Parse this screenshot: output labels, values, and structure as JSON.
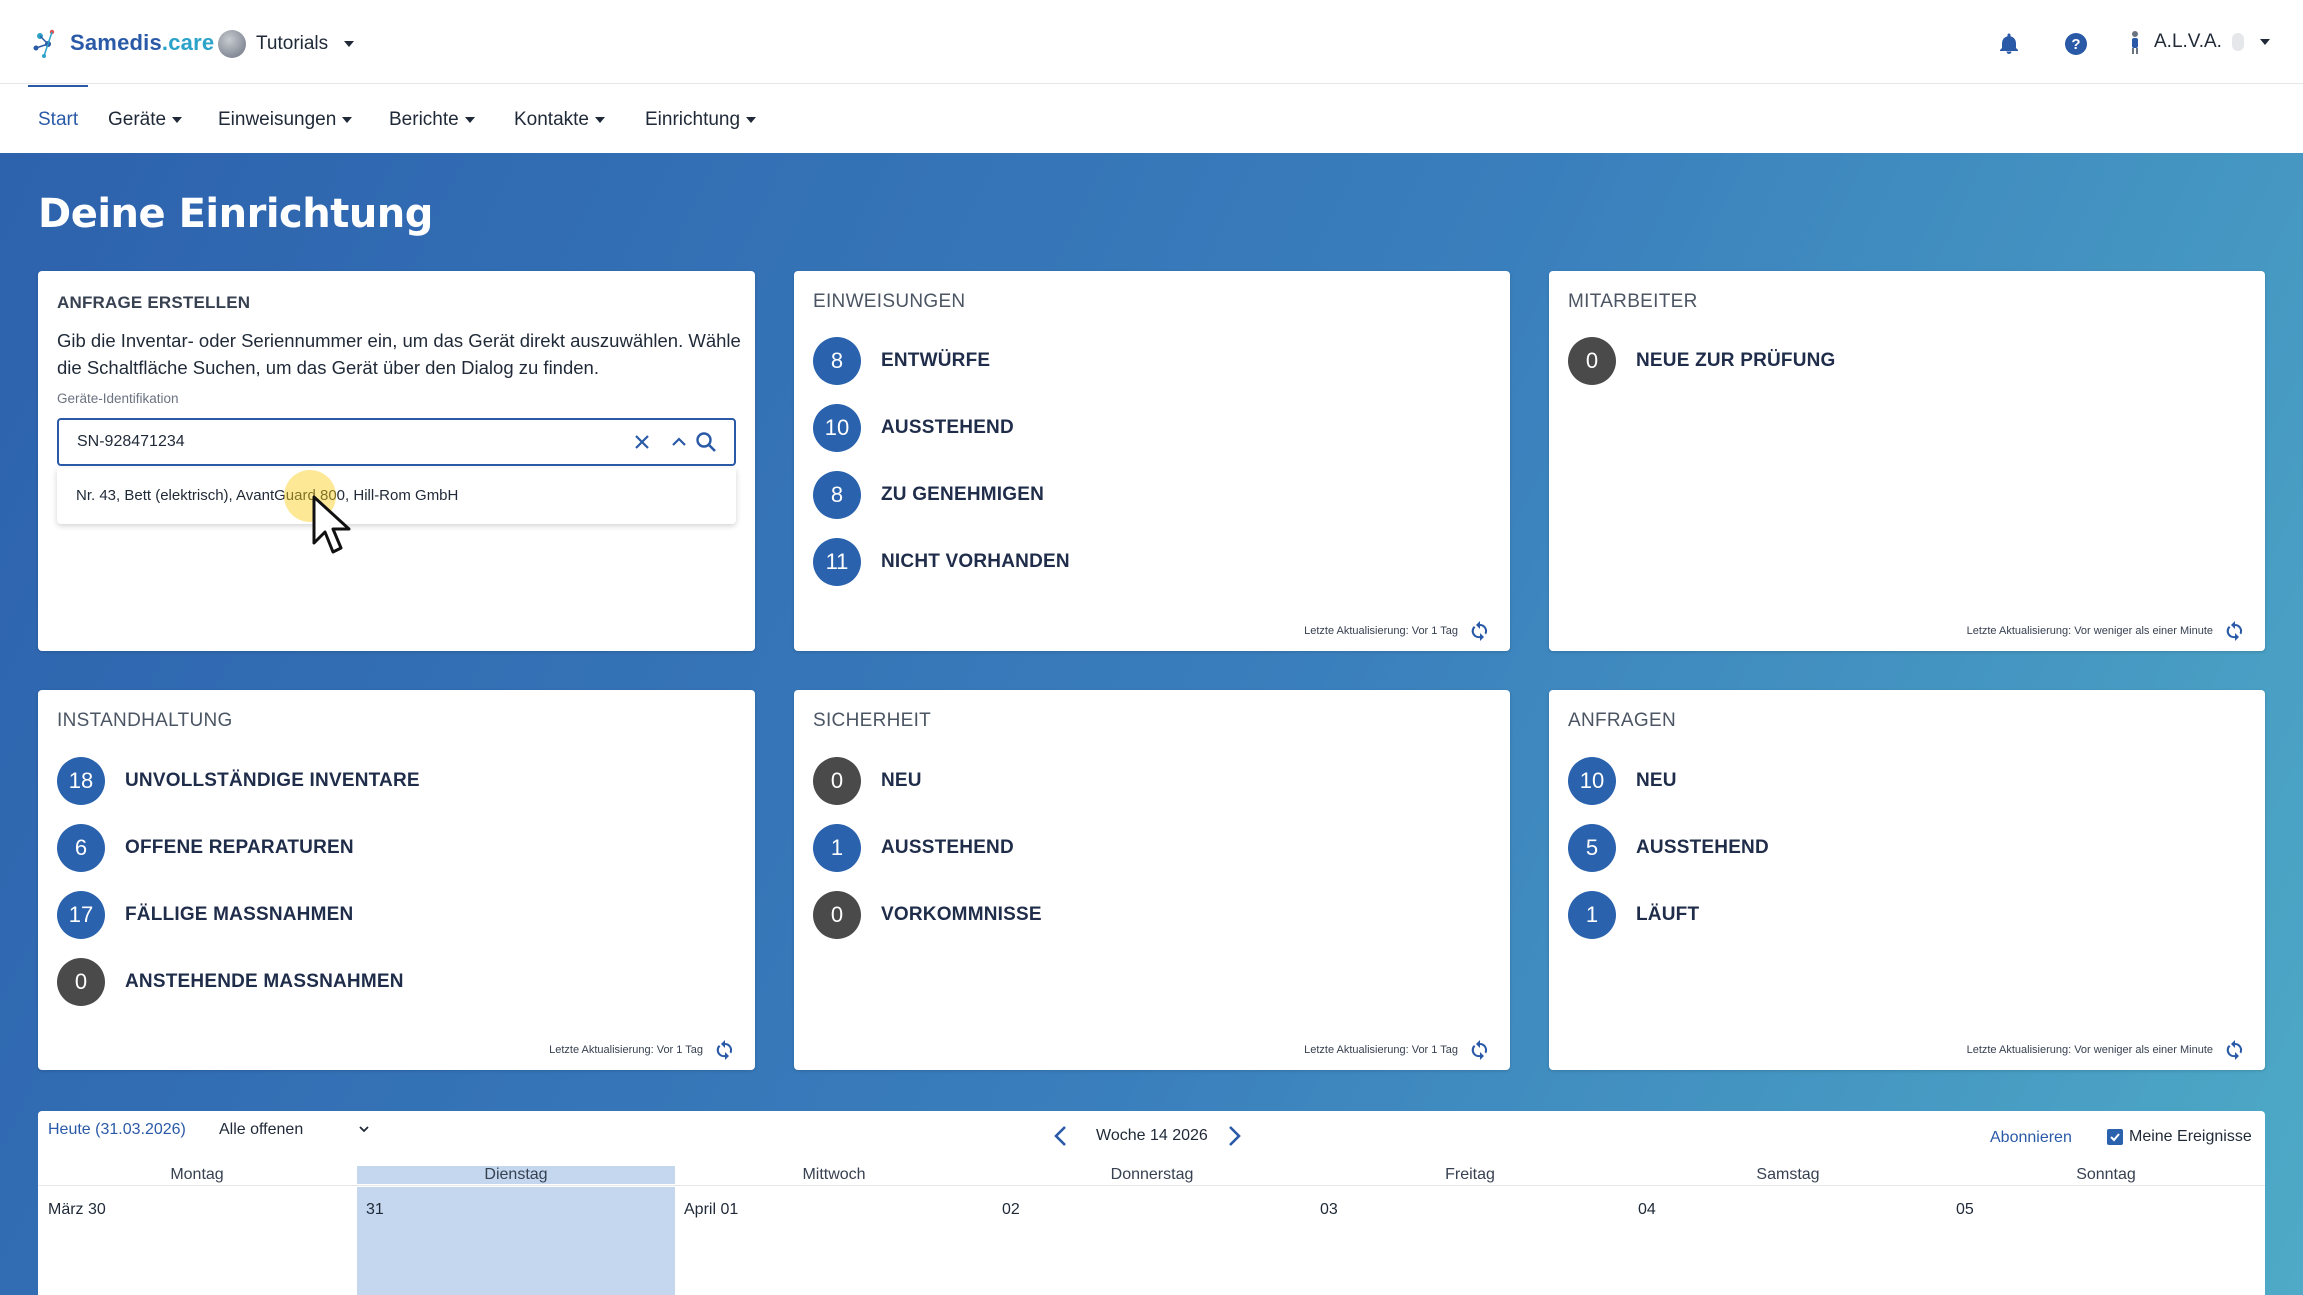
{
  "header": {
    "brand_a": "Samedis",
    "brand_b": ".care",
    "tenant": "Tutorials",
    "user": "A.L.V.A."
  },
  "nav": {
    "items": [
      {
        "label": "Start",
        "dropdown": false,
        "active": true
      },
      {
        "label": "Geräte",
        "dropdown": true
      },
      {
        "label": "Einweisungen",
        "dropdown": true
      },
      {
        "label": "Berichte",
        "dropdown": true
      },
      {
        "label": "Kontakte",
        "dropdown": true
      },
      {
        "label": "Einrichtung",
        "dropdown": true
      }
    ]
  },
  "page": {
    "title": "Deine Einrichtung"
  },
  "request": {
    "title": "ANFRAGE ERSTELLEN",
    "description": "Gib die Inventar- oder Seriennummer ein, um das Gerät direkt auszuwählen. Wähle die Schaltfläche Suchen, um das Gerät über den Dialog zu finden.",
    "field_label": "Geräte-Identifikation",
    "field_value": "SN-928471234",
    "suggestion": "Nr. 43, Bett (elektrisch), AvantGuard 800, Hill-Rom GmbH"
  },
  "cards": {
    "einweisungen": {
      "title": "EINWEISUNGEN",
      "stats": [
        {
          "value": "8",
          "label": "ENTWÜRFE",
          "color": "blue"
        },
        {
          "value": "10",
          "label": "AUSSTEHEND",
          "color": "blue"
        },
        {
          "value": "8",
          "label": "ZU GENEHMIGEN",
          "color": "blue"
        },
        {
          "value": "11",
          "label": "NICHT VORHANDEN",
          "color": "blue"
        }
      ],
      "footer": "Letzte Aktualisierung: Vor 1 Tag"
    },
    "mitarbeiter": {
      "title": "MITARBEITER",
      "stats": [
        {
          "value": "0",
          "label": "NEUE ZUR PRÜFUNG",
          "color": "dark"
        }
      ],
      "footer": "Letzte Aktualisierung: Vor weniger als einer Minute"
    },
    "instandhaltung": {
      "title": "INSTANDHALTUNG",
      "stats": [
        {
          "value": "18",
          "label": "UNVOLLSTÄNDIGE INVENTARE",
          "color": "blue"
        },
        {
          "value": "6",
          "label": "OFFENE REPARATUREN",
          "color": "blue"
        },
        {
          "value": "17",
          "label": "FÄLLIGE MASSNAHMEN",
          "color": "blue"
        },
        {
          "value": "0",
          "label": "ANSTEHENDE MASSNAHMEN",
          "color": "dark"
        }
      ],
      "footer": "Letzte Aktualisierung: Vor 1 Tag"
    },
    "sicherheit": {
      "title": "SICHERHEIT",
      "stats": [
        {
          "value": "0",
          "label": "NEU",
          "color": "dark"
        },
        {
          "value": "1",
          "label": "AUSSTEHEND",
          "color": "blue"
        },
        {
          "value": "0",
          "label": "VORKOMMNISSE",
          "color": "dark"
        }
      ],
      "footer": "Letzte Aktualisierung: Vor 1 Tag"
    },
    "anfragen": {
      "title": "ANFRAGEN",
      "stats": [
        {
          "value": "10",
          "label": "NEU",
          "color": "blue"
        },
        {
          "value": "5",
          "label": "AUSSTEHEND",
          "color": "blue"
        },
        {
          "value": "1",
          "label": "LÄUFT",
          "color": "blue"
        }
      ],
      "footer": "Letzte Aktualisierung: Vor weniger als einer Minute"
    }
  },
  "calendar": {
    "today": "Heute (31.03.2026)",
    "filter": "Alle offenen",
    "week": "Woche 14 2026",
    "subscribe": "Abonnieren",
    "my_events": "Meine Ereignisse",
    "my_events_checked": true,
    "weekdays": [
      "Montag",
      "Dienstag",
      "Mittwoch",
      "Donnerstag",
      "Freitag",
      "Samstag",
      "Sonntag"
    ],
    "dates": [
      "März 30",
      "31",
      "April 01",
      "02",
      "03",
      "04",
      "05"
    ],
    "selected_index": 1
  },
  "colors": {
    "accent": "#2a5aa7",
    "badge_blue": "#2a62ad",
    "badge_dark": "#4a4a4a",
    "selected_day": "#c4d7ee"
  }
}
